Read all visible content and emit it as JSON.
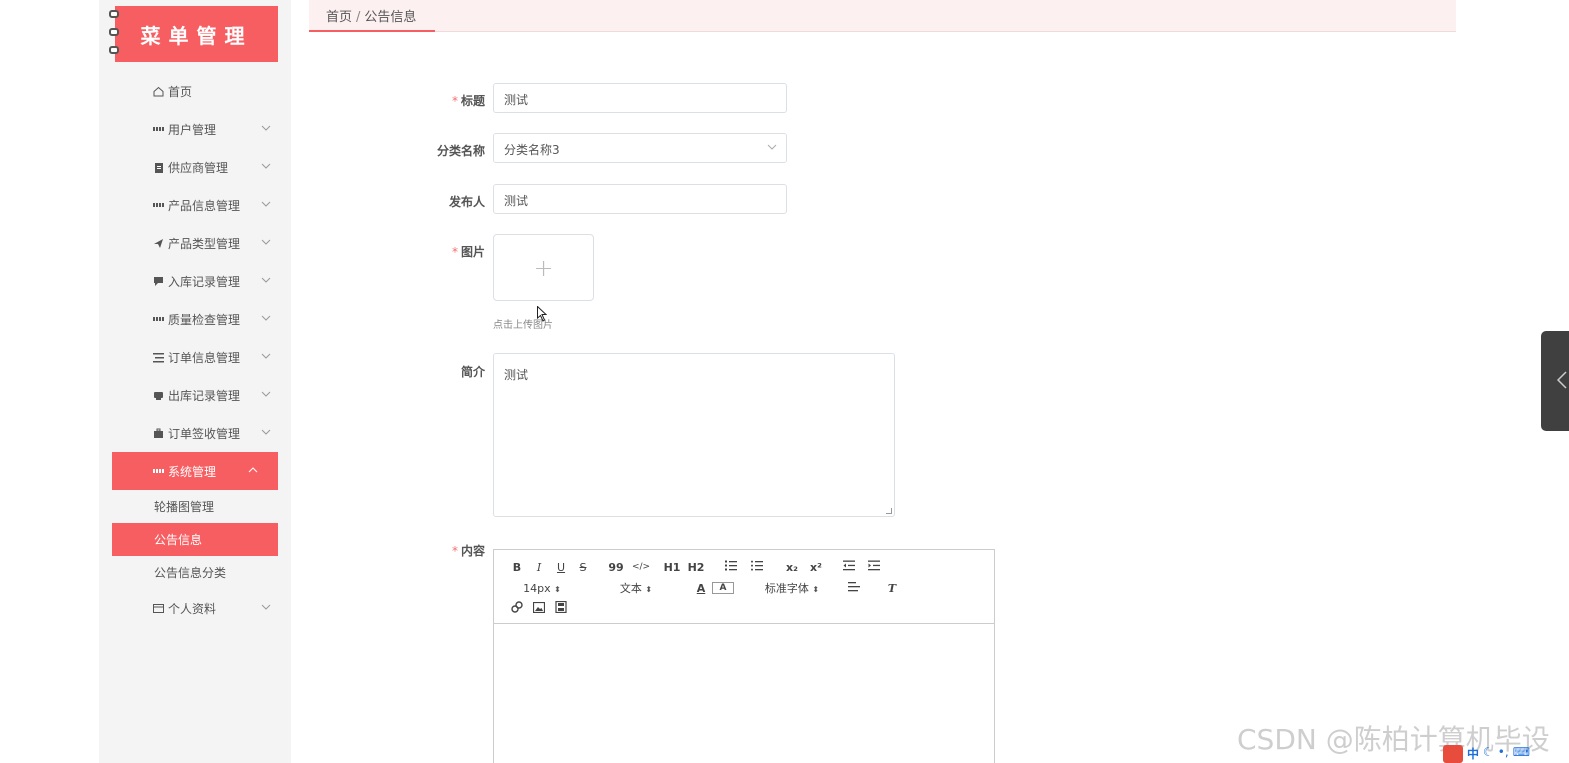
{
  "sidebar": {
    "logo_text": "菜单管理",
    "items": [
      {
        "label": "首页",
        "icon": "home-icon"
      },
      {
        "label": "用户管理",
        "icon": "grid-icon"
      },
      {
        "label": "供应商管理",
        "icon": "clipboard-icon"
      },
      {
        "label": "产品信息管理",
        "icon": "grid-icon"
      },
      {
        "label": "产品类型管理",
        "icon": "send-icon"
      },
      {
        "label": "入库记录管理",
        "icon": "chat-icon"
      },
      {
        "label": "质量检查管理",
        "icon": "grid-icon"
      },
      {
        "label": "订单信息管理",
        "icon": "list-icon"
      },
      {
        "label": "出库记录管理",
        "icon": "printer-icon"
      },
      {
        "label": "订单签收管理",
        "icon": "briefcase-icon"
      },
      {
        "label": "系统管理",
        "icon": "grid-icon"
      }
    ],
    "sub_items": [
      {
        "label": "轮播图管理"
      },
      {
        "label": "公告信息"
      },
      {
        "label": "公告信息分类"
      }
    ],
    "profile": {
      "label": "个人资料",
      "icon": "card-icon"
    }
  },
  "breadcrumb": {
    "home": "首页",
    "separator": "/",
    "current": "公告信息"
  },
  "form": {
    "title": {
      "label": "标题",
      "value": "测试"
    },
    "category": {
      "label": "分类名称",
      "value": "分类名称3"
    },
    "publisher": {
      "label": "发布人",
      "value": "测试"
    },
    "image": {
      "label": "图片",
      "plus": "+",
      "hint": "点击上传图片"
    },
    "summary": {
      "label": "简介",
      "value": "测试"
    },
    "content": {
      "label": "内容"
    },
    "required_mark": "*"
  },
  "editor": {
    "row1": [
      "B",
      "I",
      "U",
      "S",
      "99",
      "</>",
      "H1",
      "H2",
      "ol",
      "ul",
      "x₂",
      "x²",
      "outdent",
      "indent"
    ],
    "font_size": "14px",
    "text_style": "文本",
    "font_family": "标准字体"
  },
  "watermark": "CSDN @陈柏计算机毕设",
  "tray": {
    "ime": "中"
  },
  "colors": {
    "accent": "#f75e62",
    "topbar": "#fdf0f0",
    "sidebar": "#f4f4f5"
  }
}
